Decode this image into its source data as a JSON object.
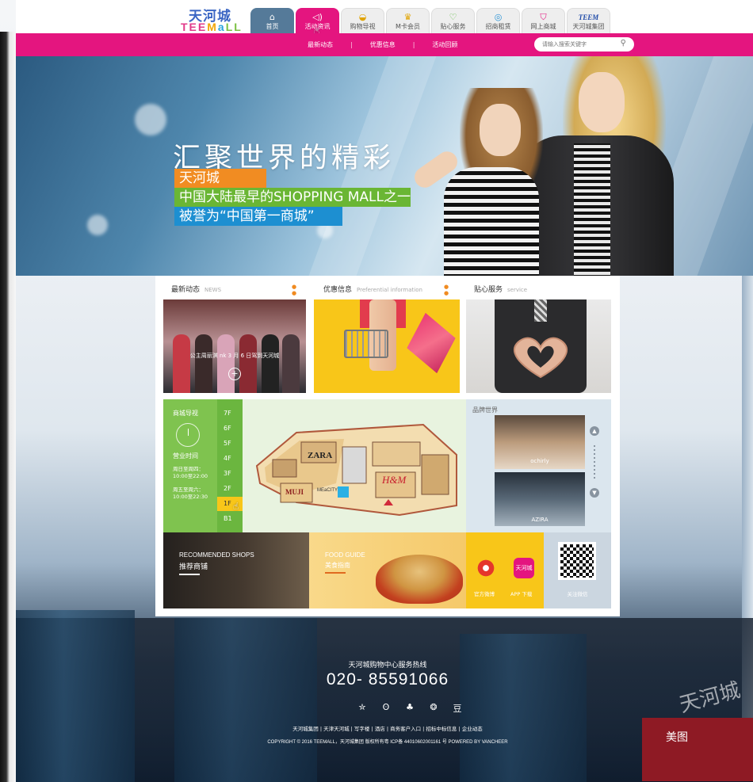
{
  "brand": {
    "logo_cn": "天河城",
    "logo_en": [
      "TEE",
      "M",
      "a",
      "LL"
    ]
  },
  "nav": {
    "tabs": [
      {
        "label": "首页",
        "icon": "home-icon",
        "glyph": "⌂"
      },
      {
        "label": "活动资讯",
        "icon": "speaker-icon",
        "glyph": "◁)"
      },
      {
        "label": "购物导视",
        "icon": "shopping-bag-icon",
        "glyph": "◒"
      },
      {
        "label": "M卡会员",
        "icon": "crown-icon",
        "glyph": "♛"
      },
      {
        "label": "贴心服务",
        "icon": "heart-icon",
        "glyph": "♡"
      },
      {
        "label": "招商租赁",
        "icon": "handshake-icon",
        "glyph": "◎"
      },
      {
        "label": "网上商城",
        "icon": "cart-icon",
        "glyph": "⛉"
      },
      {
        "label": "天河城集团",
        "icon": "teem-logo-icon",
        "glyph": "TEEM"
      }
    ],
    "active_tab": "活动资讯"
  },
  "subnav": {
    "links": [
      "最新动态",
      "优惠信息",
      "活动回顾"
    ],
    "separator": "|",
    "search_placeholder": "请输入搜索关键字"
  },
  "banner": {
    "headline": "汇聚世界的精彩",
    "taglines": [
      "天河城",
      "中国大陆最早的SHOPPING MALL之一",
      "被誉为“中国第一商城”"
    ]
  },
  "sections": {
    "news": {
      "title": "最新动态",
      "en": "NEWS",
      "caption": "公主周丽淇 nk 3 月 6 日驾到天河城",
      "plus": "+"
    },
    "promo": {
      "title": "优惠信息",
      "en": "Preferential information"
    },
    "service": {
      "title": "贴心服务",
      "en": "service"
    },
    "more_dots": "● ●"
  },
  "guide": {
    "title": "商城导视",
    "hours_title": "营业时间",
    "hours": [
      {
        "days": "周日至周四：",
        "time": "10:00至22:00"
      },
      {
        "days": "周五至周六：",
        "time": "10:00至22:30"
      }
    ],
    "floors": [
      "7F",
      "6F",
      "5F",
      "4F",
      "3F",
      "2F",
      "1F",
      "B1"
    ],
    "active_floor": "1F",
    "map_labels": [
      "ZARA",
      "MUJI",
      "H&M",
      "MEaCITY"
    ]
  },
  "brands": {
    "title": "品牌世界",
    "items": [
      "ochirly",
      "AZIRA"
    ],
    "arrow_up": "▲",
    "arrow_down": "▼"
  },
  "bottom": {
    "recommended_en": "RECOMMENDED SHOPS",
    "recommended_cn": "推荐商铺",
    "food_en": "FOOD GUIDE",
    "food_cn": "美食指南",
    "weibo_label": "官方微博",
    "app_label": "APP 下载",
    "app_icon_text": "天河城",
    "wechat_label": "关注微信"
  },
  "footer": {
    "hotline_label": "天河城购物中心服务热线",
    "hotline": "020- 85591066",
    "social_glyphs": [
      "✮",
      "ʘ",
      "♣",
      "❂",
      "豆"
    ],
    "links": "天河城集团 | 天津天河城 | 写字楼 | 酒店 | 商务客户入口 | 招标中标信息 | 企业动态",
    "copyright": "COPYRIGHT © 2016 TEEMALL，天河城集团 版权所有粤 ICP备 44010602001161 号 POWERED BY VANCHEER",
    "building_sign": "天河城",
    "red_sign": "美图"
  },
  "colors": {
    "brand_pink": "#e4157f",
    "nav_blue": "#557a99",
    "accent_yellow": "#f8c619",
    "accent_green": "#6ab634",
    "accent_orange": "#f18c22",
    "accent_blue": "#1d8fd1"
  }
}
